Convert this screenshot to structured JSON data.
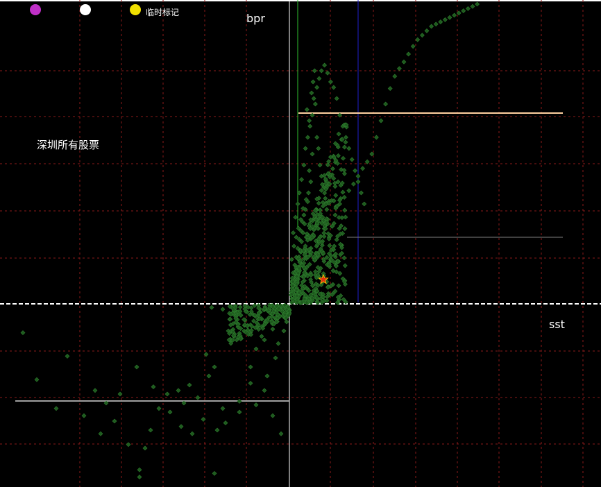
{
  "legend": [
    {
      "color": "#c030c8",
      "label": ""
    },
    {
      "color": "#ffffff",
      "label": ""
    },
    {
      "color": "#f0e000",
      "label": "临时标记"
    }
  ],
  "title": "深圳所有股票",
  "y_axis_label": "bpr",
  "x_axis_label": "sst",
  "colors": {
    "background": "#000000",
    "grid": "#8b1a1a",
    "points": "#1e5a1e",
    "axes": "#ffffff",
    "marker_star": "#e03010"
  },
  "chart_data": {
    "type": "scatter",
    "title": "深圳所有股票",
    "xlabel": "sst",
    "ylabel": "bpr",
    "xlim": [
      -100,
      100
    ],
    "ylim": [
      -100,
      100
    ],
    "grid": true,
    "series": [
      {
        "name": "",
        "points": [
          [
            -80,
            -29
          ],
          [
            -30,
            -28
          ],
          [
            -55,
            -35
          ],
          [
            -40,
            -48
          ],
          [
            -33,
            -52
          ],
          [
            -24,
            -58
          ],
          [
            -18,
            -54
          ],
          [
            -14,
            -44
          ],
          [
            -12,
            -56
          ],
          [
            -9,
            -48
          ],
          [
            -6,
            -62
          ],
          [
            -3,
            -72
          ],
          [
            -8,
            -40
          ],
          [
            -5,
            -30
          ],
          [
            -4,
            -22
          ],
          [
            -2,
            -15
          ],
          [
            -1,
            -10
          ],
          [
            -7,
            -5
          ],
          [
            -11,
            -8
          ],
          [
            -15,
            -12
          ],
          [
            -19,
            -20
          ],
          [
            -22,
            -15
          ],
          [
            -27,
            -35
          ],
          [
            -29,
            -40
          ],
          [
            -36,
            -45
          ],
          [
            -38,
            -55
          ],
          [
            -43,
            -60
          ],
          [
            -47,
            -58
          ],
          [
            -50,
            -70
          ],
          [
            -52,
            -80
          ],
          [
            -54,
            -92
          ],
          [
            -58,
            -78
          ],
          [
            -63,
            -65
          ],
          [
            -68,
            -72
          ],
          [
            -74,
            -62
          ],
          [
            -84,
            -58
          ],
          [
            -91,
            -42
          ],
          [
            -96,
            -16
          ],
          [
            -27,
            -94
          ],
          [
            -54,
            -96
          ],
          [
            -12,
            -25
          ],
          [
            -14,
            -35
          ],
          [
            -18,
            -60
          ],
          [
            -23,
            -66
          ],
          [
            -26,
            -70
          ],
          [
            -31,
            -64
          ],
          [
            -35,
            -72
          ],
          [
            -39,
            -68
          ],
          [
            -44,
            -50
          ],
          [
            -49,
            -46
          ],
          [
            -61,
            -50
          ],
          [
            -66,
            -55
          ],
          [
            -70,
            -48
          ],
          [
            -10,
            -18
          ],
          [
            -13,
            -6
          ],
          [
            -16,
            -9
          ],
          [
            -20,
            -4
          ],
          [
            -24,
            -3
          ],
          [
            -28,
            -2
          ],
          [
            -3,
            -3
          ],
          [
            -6,
            -14
          ],
          [
            -9,
            -20
          ],
          [
            2,
            8
          ],
          [
            4,
            12
          ],
          [
            6,
            18
          ],
          [
            8,
            25
          ],
          [
            10,
            32
          ],
          [
            12,
            40
          ],
          [
            14,
            48
          ],
          [
            16,
            56
          ],
          [
            18,
            64
          ],
          [
            20,
            72
          ],
          [
            5,
            28
          ],
          [
            7,
            35
          ],
          [
            9,
            42
          ],
          [
            11,
            50
          ],
          [
            13,
            58
          ],
          [
            15,
            66
          ],
          [
            17,
            74
          ],
          [
            19,
            80
          ],
          [
            21,
            85
          ],
          [
            3,
            40
          ],
          [
            6,
            52
          ],
          [
            9,
            60
          ],
          [
            12,
            68
          ],
          [
            15,
            76
          ],
          [
            18,
            86
          ],
          [
            22,
            94
          ],
          [
            25,
            100
          ],
          [
            24,
            92
          ],
          [
            26,
            120
          ],
          [
            28,
            110
          ],
          [
            30,
            135
          ],
          [
            27,
            160
          ],
          [
            23,
            175
          ],
          [
            29,
            190
          ],
          [
            31,
            200
          ],
          [
            33,
            210
          ],
          [
            34,
            180
          ],
          [
            36,
            150
          ],
          [
            38,
            140
          ],
          [
            40,
            125
          ],
          [
            42,
            115
          ],
          [
            45,
            105
          ],
          [
            47,
            95
          ],
          [
            49,
            85
          ],
          [
            50,
            72
          ],
          [
            52,
            60
          ],
          [
            44,
            45
          ],
          [
            41,
            32
          ],
          [
            37,
            25
          ],
          [
            35,
            18
          ],
          [
            32,
            12
          ],
          [
            28,
            8
          ],
          [
            25,
            5
          ],
          [
            22,
            3
          ],
          [
            18,
            2
          ],
          [
            14,
            1
          ],
          [
            10,
            2
          ],
          [
            6,
            4
          ],
          [
            3,
            20
          ],
          [
            5,
            64
          ],
          [
            8,
            78
          ],
          [
            11,
            90
          ],
          [
            13,
            100
          ],
          [
            16,
            112
          ],
          [
            19,
            125
          ],
          [
            21,
            140
          ],
          [
            24,
            150
          ],
          [
            26,
            165
          ],
          [
            30,
            170
          ],
          [
            32,
            185
          ],
          [
            36,
            195
          ],
          [
            39,
            203
          ],
          [
            42,
            210
          ],
          [
            46,
            215
          ],
          [
            50,
            208
          ],
          [
            54,
            200
          ],
          [
            58,
            195
          ],
          [
            62,
            185
          ],
          [
            66,
            170
          ],
          [
            70,
            160
          ],
          [
            74,
            150
          ],
          [
            78,
            140
          ],
          [
            82,
            130
          ],
          [
            86,
            120
          ],
          [
            90,
            110
          ],
          [
            94,
            100
          ],
          [
            98,
            90
          ],
          [
            60,
            80
          ],
          [
            66,
            90
          ],
          [
            72,
            96
          ],
          [
            78,
            102
          ],
          [
            84,
            108
          ],
          [
            90,
            115
          ],
          [
            96,
            122
          ],
          [
            102,
            128
          ],
          [
            108,
            135
          ],
          [
            114,
            150
          ],
          [
            120,
            165
          ],
          [
            126,
            180
          ],
          [
            132,
            194
          ],
          [
            138,
            205
          ],
          [
            144,
            212
          ],
          [
            150,
            218
          ],
          [
            156,
            225
          ],
          [
            162,
            232
          ],
          [
            168,
            238
          ],
          [
            174,
            242
          ],
          [
            180,
            246
          ],
          [
            186,
            250
          ],
          [
            192,
            252
          ],
          [
            198,
            254
          ],
          [
            204,
            256
          ],
          [
            210,
            258
          ],
          [
            216,
            260
          ],
          [
            222,
            262
          ],
          [
            228,
            264
          ],
          [
            234,
            266
          ],
          [
            240,
            268
          ],
          [
            246,
            270
          ],
          [
            252,
            272
          ],
          [
            258,
            274
          ],
          [
            264,
            276
          ],
          [
            270,
            278
          ],
          [
            276,
            280
          ],
          [
            282,
            282
          ],
          [
            288,
            284
          ],
          [
            294,
            286
          ]
        ]
      }
    ],
    "reference_lines": [
      {
        "label": "",
        "color": "#ffffff",
        "orientation": "horizontal",
        "value": 0
      },
      {
        "label": "",
        "color": "#ffffff",
        "orientation": "vertical",
        "value": 0
      },
      {
        "label": "",
        "color": "#30c030",
        "orientation": "vertical",
        "value": 5
      },
      {
        "label": "",
        "color": "#2020d0",
        "orientation": "vertical",
        "value": 41
      },
      {
        "label": "",
        "color": "#ffd0a0",
        "orientation": "horizontal",
        "value": 80
      },
      {
        "label": "",
        "color": "#808080",
        "orientation": "horizontal",
        "value": 28
      },
      {
        "label": "",
        "color": "#a0a0a0",
        "orientation": "horizontal",
        "value": -40
      }
    ],
    "highlight": {
      "x": 20,
      "y": 10,
      "marker": "star"
    }
  }
}
